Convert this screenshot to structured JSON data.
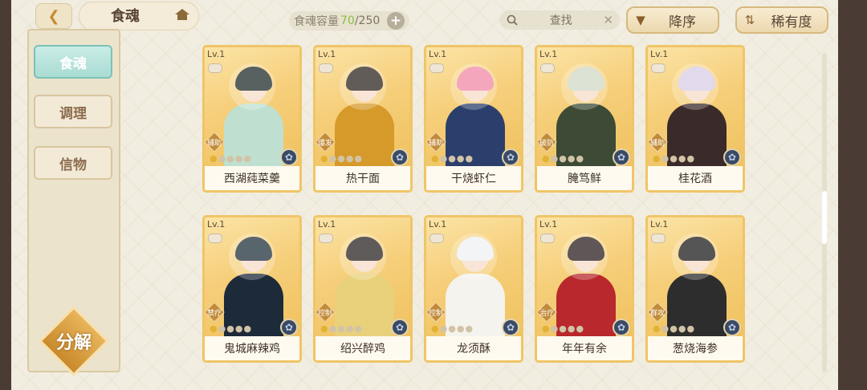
{
  "header": {
    "title": "食魂",
    "capacity_label": "食魂容量",
    "capacity_current": "70",
    "capacity_total": "/250",
    "search_label": "查找",
    "sort_order_label": "降序",
    "sort_rarity_label": "稀有度"
  },
  "sidebar": {
    "tabs": [
      "食魂",
      "调理",
      "信物"
    ],
    "decompose_label": "分解"
  },
  "cards": [
    {
      "level": "Lv.1",
      "role": "辅助",
      "name": "西湖莼菜羹",
      "stars": 1,
      "hair": "#1f2c2a",
      "outfit": "#bfe0d0"
    },
    {
      "level": "Lv.1",
      "role": "爆发",
      "name": "热干面",
      "stars": 1,
      "hair": "#2e2622",
      "outfit": "#d69a2a"
    },
    {
      "level": "Lv.1",
      "role": "辅助",
      "name": "干烧虾仁",
      "stars": 1,
      "hair": "#f08aa6",
      "outfit": "#2c3f6c"
    },
    {
      "level": "Lv.1",
      "role": "破防",
      "name": "腌笃鲜",
      "stars": 1,
      "hair": "#cfd8c6",
      "outfit": "#3c4a36"
    },
    {
      "level": "Lv.1",
      "role": "辅助",
      "name": "桂花酒",
      "stars": 1,
      "hair": "#d8cde6",
      "outfit": "#3a2a2a"
    },
    {
      "level": "Lv.1",
      "role": "禁疗",
      "name": "鬼城麻辣鸡",
      "stars": 1,
      "hair": "#22323c",
      "outfit": "#1d2a3a"
    },
    {
      "level": "Lv.1",
      "role": "控制",
      "name": "绍兴醉鸡",
      "stars": 1,
      "hair": "#2a2424",
      "outfit": "#e9d07a"
    },
    {
      "level": "Lv.1",
      "role": "控制",
      "name": "龙须酥",
      "stars": 1,
      "hair": "#eef0f2",
      "outfit": "#f5f3ee"
    },
    {
      "level": "Lv.1",
      "role": "治疗",
      "name": "年年有余",
      "stars": 1,
      "hair": "#2a1f1f",
      "outfit": "#b8282c"
    },
    {
      "level": "Lv.1",
      "role": "群攻",
      "name": "葱烧海参",
      "stars": 1,
      "hair": "#1e1c1c",
      "outfit": "#2d2d2d"
    }
  ]
}
